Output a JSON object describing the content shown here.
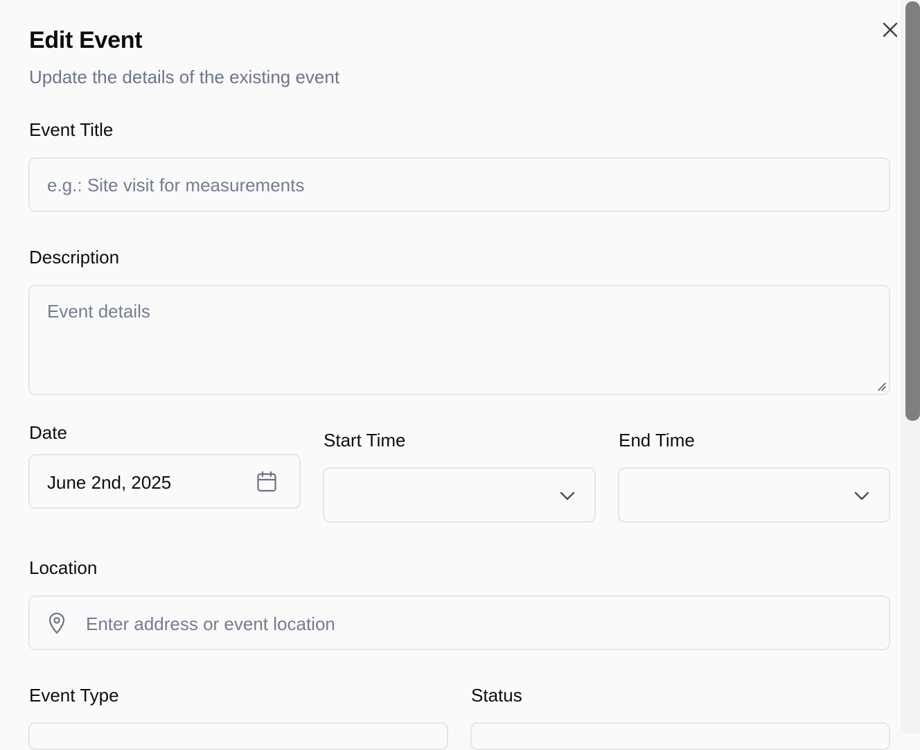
{
  "dialog": {
    "title": "Edit Event",
    "subtitle": "Update the details of the existing event",
    "close_icon": "close-icon"
  },
  "fields": {
    "event_title": {
      "label": "Event Title",
      "value": "",
      "placeholder": "e.g.: Site visit for measurements"
    },
    "description": {
      "label": "Description",
      "value": "",
      "placeholder": "Event details"
    },
    "date": {
      "label": "Date",
      "value": "June 2nd, 2025",
      "icon": "calendar-icon"
    },
    "start_time": {
      "label": "Start Time",
      "value": "",
      "icon": "chevron-down-icon"
    },
    "end_time": {
      "label": "End Time",
      "value": "",
      "icon": "chevron-down-icon"
    },
    "location": {
      "label": "Location",
      "value": "",
      "placeholder": "Enter address or event location",
      "icon": "map-pin-icon"
    },
    "event_type": {
      "label": "Event Type",
      "value": ""
    },
    "status": {
      "label": "Status",
      "value": ""
    }
  },
  "colors": {
    "background": "#fafafa",
    "border": "#e3e5ea",
    "text": "#0b0d12",
    "muted": "#6b7689",
    "scrollbar_thumb": "#7f7f80"
  }
}
